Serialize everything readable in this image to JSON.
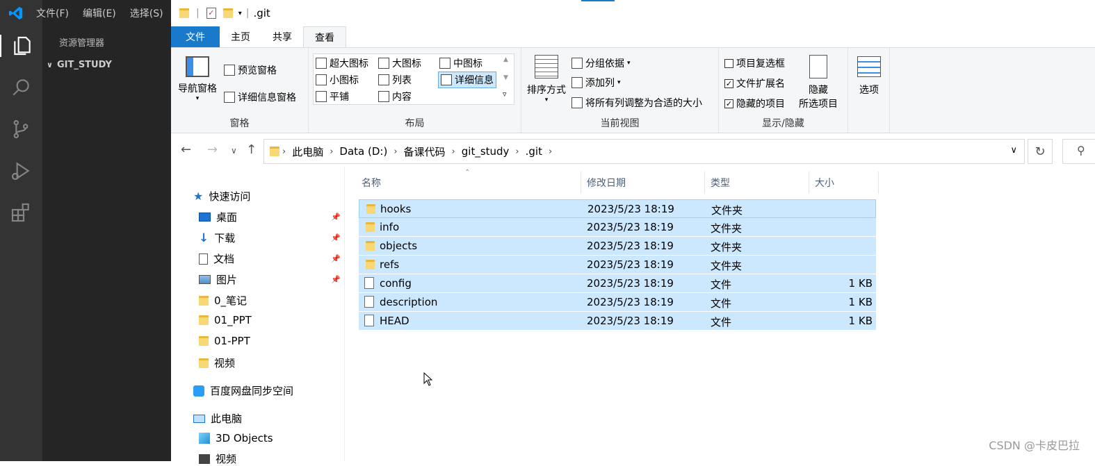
{
  "vscode": {
    "menu": [
      "文件(F)",
      "编辑(E)",
      "选择(S)"
    ],
    "explorer_title": "资源管理器",
    "folder": "GIT_STUDY",
    "accent": "#007acc"
  },
  "explorer": {
    "window_title": ".git",
    "tabs": [
      "文件",
      "主页",
      "共享",
      "查看"
    ],
    "active_tab": "查看",
    "ribbon": {
      "pane_group": {
        "label": "窗格",
        "nav_pane": "导航窗格",
        "preview": "预览窗格",
        "details_pane": "详细信息窗格"
      },
      "layout_group": {
        "label": "布局",
        "items": [
          "超大图标",
          "大图标",
          "中图标",
          "小图标",
          "列表",
          "详细信息",
          "平铺",
          "内容"
        ],
        "selected": "详细信息"
      },
      "view_group": {
        "label": "当前视图",
        "sort": "排序方式",
        "group_by": "分组依据",
        "add_col": "添加列",
        "fit_cols": "将所有列调整为合适的大小"
      },
      "show_group": {
        "label": "显示/隐藏",
        "item_checkbox": "项目复选框",
        "file_ext": "文件扩展名",
        "hidden_items": "隐藏的项目",
        "hide_selected_1": "隐藏",
        "hide_selected_2": "所选项目"
      },
      "options": "选项"
    },
    "breadcrumb": [
      "此电脑",
      "Data (D:)",
      "备课代码",
      "git_study",
      ".git"
    ],
    "nav_pane": {
      "quick_access": "快速访问",
      "items": [
        "桌面",
        "下载",
        "文档",
        "图片",
        "0_笔记",
        "01_PPT",
        "01-PPT",
        "视频"
      ],
      "baidu": "百度网盘同步空间",
      "this_pc": "此电脑",
      "objects3d": "3D Objects",
      "videos": "视频"
    },
    "columns": [
      "名称",
      "修改日期",
      "类型",
      "大小"
    ],
    "files": [
      {
        "name": "hooks",
        "date": "2023/5/23 18:19",
        "type": "文件夹",
        "size": "",
        "folder": true
      },
      {
        "name": "info",
        "date": "2023/5/23 18:19",
        "type": "文件夹",
        "size": "",
        "folder": true
      },
      {
        "name": "objects",
        "date": "2023/5/23 18:19",
        "type": "文件夹",
        "size": "",
        "folder": true
      },
      {
        "name": "refs",
        "date": "2023/5/23 18:19",
        "type": "文件夹",
        "size": "",
        "folder": true
      },
      {
        "name": "config",
        "date": "2023/5/23 18:19",
        "type": "文件",
        "size": "1 KB",
        "folder": false
      },
      {
        "name": "description",
        "date": "2023/5/23 18:19",
        "type": "文件",
        "size": "1 KB",
        "folder": false
      },
      {
        "name": "HEAD",
        "date": "2023/5/23 18:19",
        "type": "文件",
        "size": "1 KB",
        "folder": false
      }
    ],
    "selection_color": "#cce8ff",
    "file_tab_color": "#1979ca"
  },
  "watermark": "CSDN @卡皮巴拉"
}
